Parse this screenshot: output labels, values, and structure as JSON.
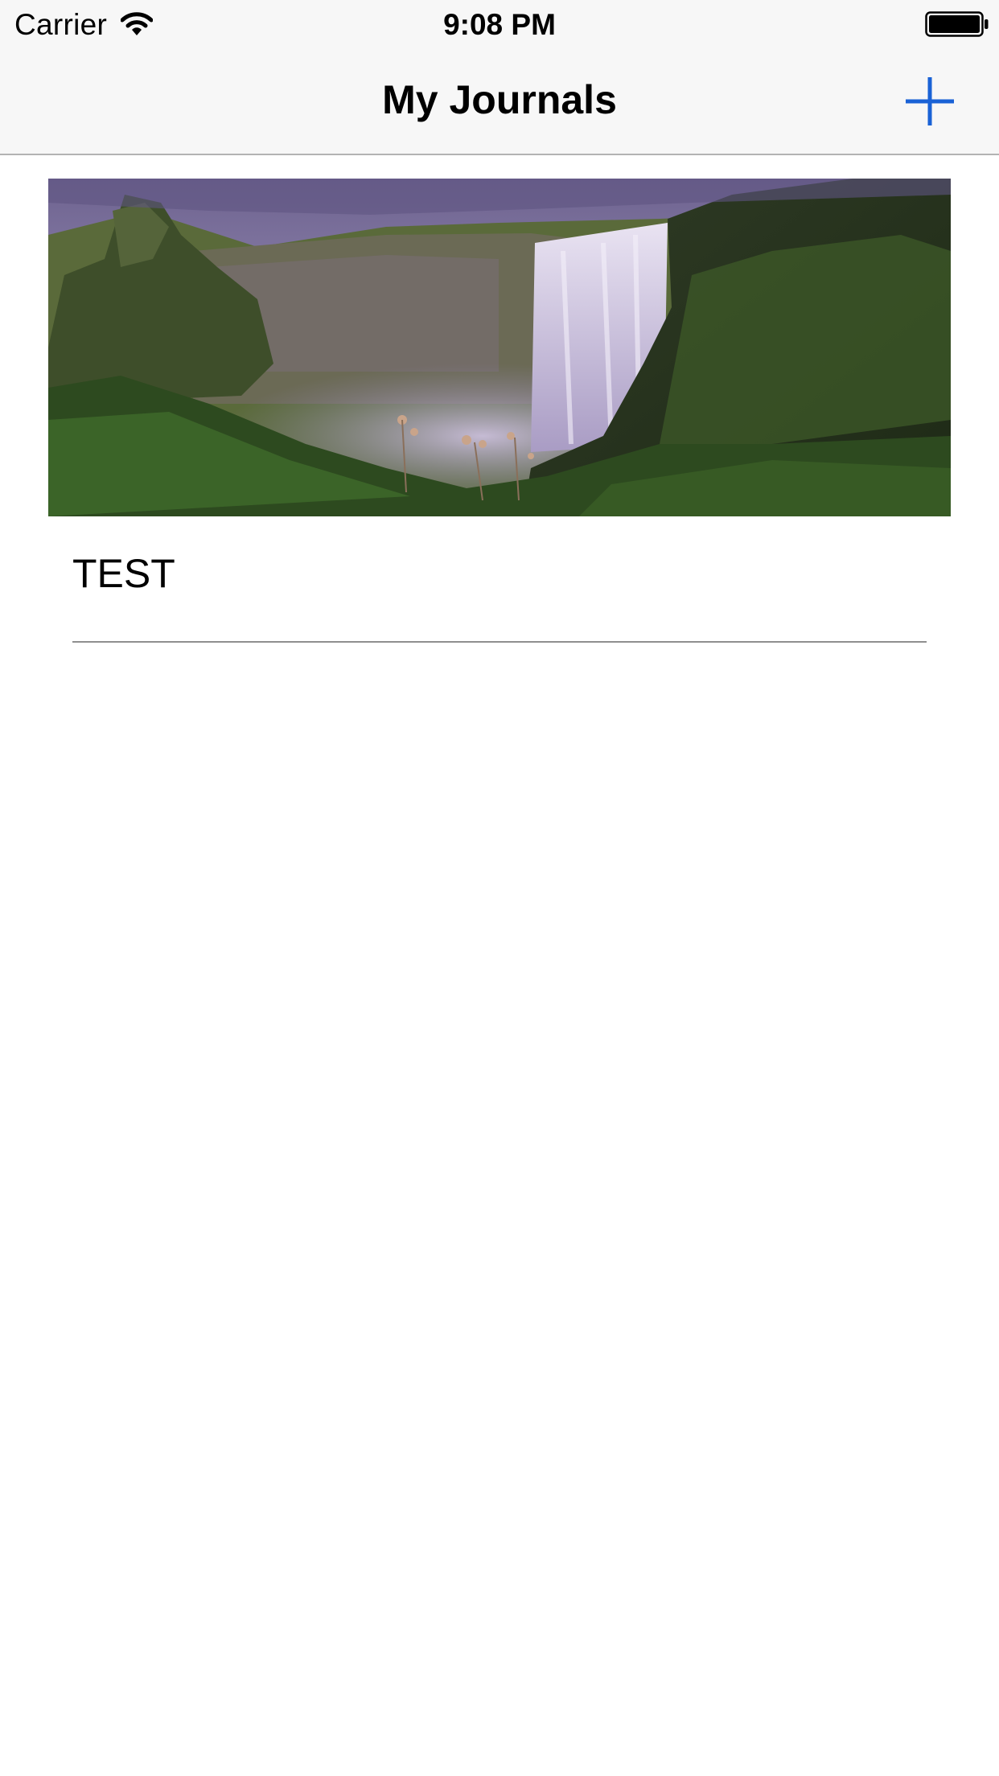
{
  "status_bar": {
    "carrier": "Carrier",
    "time": "9:08 PM",
    "wifi_icon": "wifi-icon",
    "battery_icon": "battery-full-icon"
  },
  "nav_bar": {
    "title": "My Journals",
    "add_icon": "plus-icon",
    "accent_color": "#1a62d6"
  },
  "journals": [
    {
      "title": "TEST",
      "image": "waterfall-photo"
    }
  ]
}
